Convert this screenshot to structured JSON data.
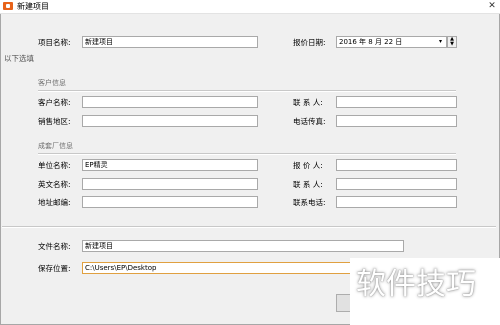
{
  "window": {
    "title": "新建项目",
    "close_glyph": "✕"
  },
  "project": {
    "name_label": "项目名称:",
    "name_value": "新建项目",
    "date_label": "报价日期:",
    "date_value": "2016 年  8 月 22 日"
  },
  "optional_label": "以下选填",
  "customer": {
    "group_title": "客户信息",
    "name_label": "客户名称:",
    "region_label": "销售地区:",
    "contact_label": "联 系 人:",
    "phone_fax_label": "电话传真:"
  },
  "manufacturer": {
    "group_title": "成套厂信息",
    "unit_label": "单位名称:",
    "unit_value": "EP精灵",
    "english_label": "英文名称:",
    "address_label": "地址邮编:",
    "quoter_label": "报 价 人:",
    "contact_label": "联 系 人:",
    "phone_label": "联系电话:"
  },
  "file": {
    "name_label": "文件名称:",
    "name_value": "新建项目",
    "location_label": "保存位置:",
    "location_value": "C:\\Users\\EP\\Desktop"
  },
  "watermark": "软件技巧"
}
